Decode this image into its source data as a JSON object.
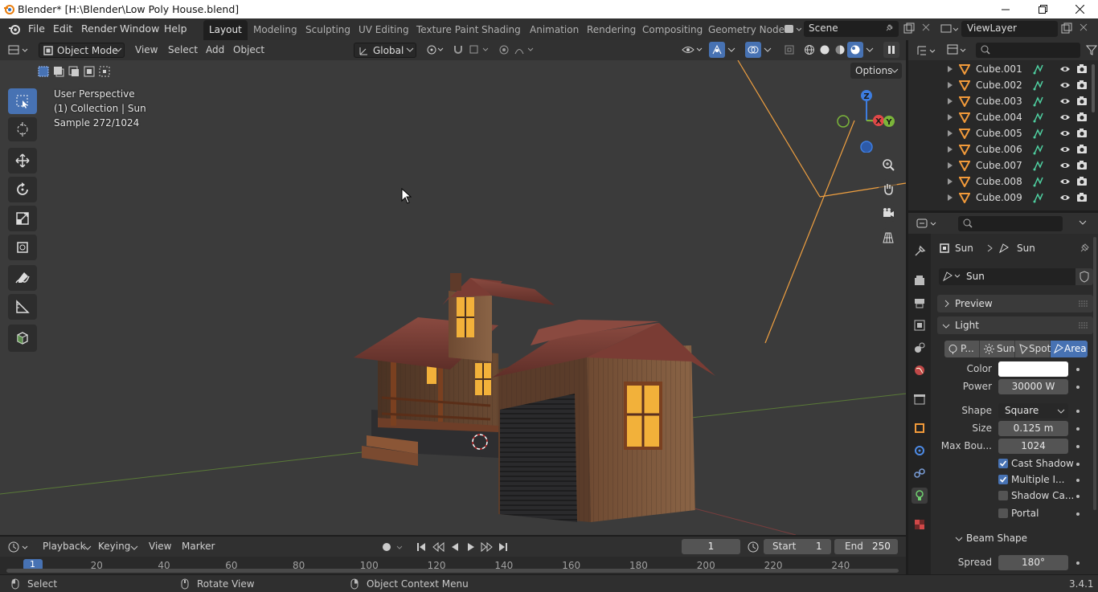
{
  "window": {
    "title": "Blender* [H:\\Blender\\Low Poly House.blend]"
  },
  "menus": [
    "File",
    "Edit",
    "Render",
    "Window",
    "Help"
  ],
  "workspaces": [
    "Layout",
    "Modeling",
    "Sculpting",
    "UV Editing",
    "Texture Paint",
    "Shading",
    "Animation",
    "Rendering",
    "Compositing",
    "Geometry Node"
  ],
  "active_workspace": "Layout",
  "scene": {
    "name": "Scene",
    "view_layer": "ViewLayer"
  },
  "viewport_header": {
    "mode": "Object Mode",
    "menus": [
      "View",
      "Select",
      "Add",
      "Object"
    ],
    "transform_orientation": "Global",
    "options_label": "Options"
  },
  "viewport_overlay": {
    "line1": "User Perspective",
    "line2": "(1) Collection | Sun",
    "line3": "Sample 272/1024"
  },
  "gizmo": {
    "z": "Z",
    "x": "X",
    "y": "Y"
  },
  "outliner": {
    "items": [
      "Cube.001",
      "Cube.002",
      "Cube.003",
      "Cube.004",
      "Cube.005",
      "Cube.006",
      "Cube.007",
      "Cube.008",
      "Cube.009"
    ]
  },
  "properties": {
    "breadcrumb_object": "Sun",
    "breadcrumb_data": "Sun",
    "datablock_name": "Sun",
    "preview_label": "Preview",
    "light_label": "Light",
    "light_types": [
      "P...",
      "Sun",
      "Spot",
      "Area"
    ],
    "active_light_type": "Area",
    "color_label": "Color",
    "color_value": "#ffffff",
    "power_label": "Power",
    "power_value": "30000 W",
    "shape_label": "Shape",
    "shape_value": "Square",
    "size_label": "Size",
    "size_value": "0.125 m",
    "max_bounces_label": "Max Bou...",
    "max_bounces_value": "1024",
    "cast_shadow": {
      "label": "Cast Shadow",
      "checked": true
    },
    "multiple_importance": {
      "label": "Multiple I...",
      "checked": true
    },
    "shadow_caustics": {
      "label": "Shadow Ca...",
      "checked": false
    },
    "portal": {
      "label": "Portal",
      "checked": false
    },
    "beam_shape_label": "Beam Shape",
    "spread_label": "Spread",
    "spread_value": "180°"
  },
  "timeline": {
    "menus": [
      "Playback",
      "Keying",
      "View",
      "Marker"
    ],
    "current_frame": "1",
    "start_label": "Start",
    "start_value": "1",
    "end_label": "End",
    "end_value": "250",
    "ruler": [
      "1",
      "20",
      "40",
      "60",
      "80",
      "100",
      "120",
      "140",
      "160",
      "180",
      "200",
      "220",
      "240"
    ]
  },
  "statusbar": {
    "select": "Select",
    "rotate": "Rotate View",
    "context": "Object Context Menu",
    "version": "3.4.1"
  },
  "colors": {
    "accent": "#4772b3",
    "light_orange": "#f0a040",
    "window_glow": "#f2b13a"
  }
}
